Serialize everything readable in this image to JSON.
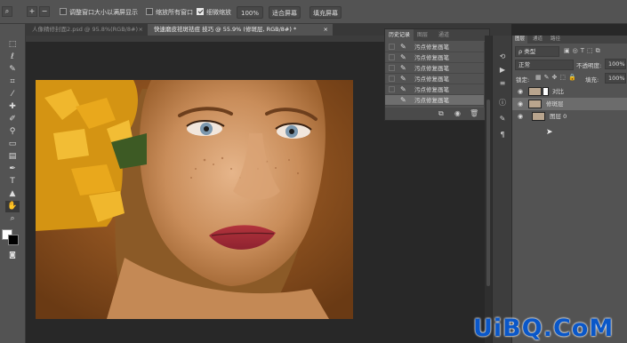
{
  "options_bar": {
    "resize_windows_label": "调整窗口大小以满屏显示",
    "zoom_all_label": "缩放所有窗口",
    "scrubby_zoom_label": "细微缩放",
    "zoom_value": "100%",
    "fit_screen_label": "适合屏幕",
    "fill_screen_label": "填充屏幕"
  },
  "tabs": [
    {
      "label": "人像精修封面2.psd @ 95.8%(RGB/8#)",
      "close": "×"
    },
    {
      "label": "快速磨皮祛斑祛痘 技巧 @ 55.9% (修斑层, RGB/8#) *",
      "close": "×"
    }
  ],
  "history_panel": {
    "tabs": [
      "历史记录",
      "图层",
      "通道"
    ],
    "items": [
      "污点修复画笔",
      "污点修复画笔",
      "污点修复画笔",
      "污点修复画笔",
      "污点修复画笔",
      "污点修复画笔"
    ],
    "current_index": 5
  },
  "layers_panel": {
    "tabs": [
      "图层",
      "通道",
      "路径"
    ],
    "filter_kind": "ρ 类型",
    "blend_mode": "正常",
    "opacity_label": "不透明度:",
    "opacity_value": "100%",
    "lock_label": "锁定:",
    "fill_label": "填充:",
    "fill_value": "100%",
    "layers": [
      {
        "name": "对比",
        "selected": false
      },
      {
        "name": "修斑层",
        "selected": true
      },
      {
        "name": "图层 0",
        "selected": false
      }
    ]
  },
  "watermark": "UiBQ.CoM",
  "colors": {
    "panel": "#535353",
    "background": "#282828",
    "watermark_blue": "#0a57c8"
  }
}
